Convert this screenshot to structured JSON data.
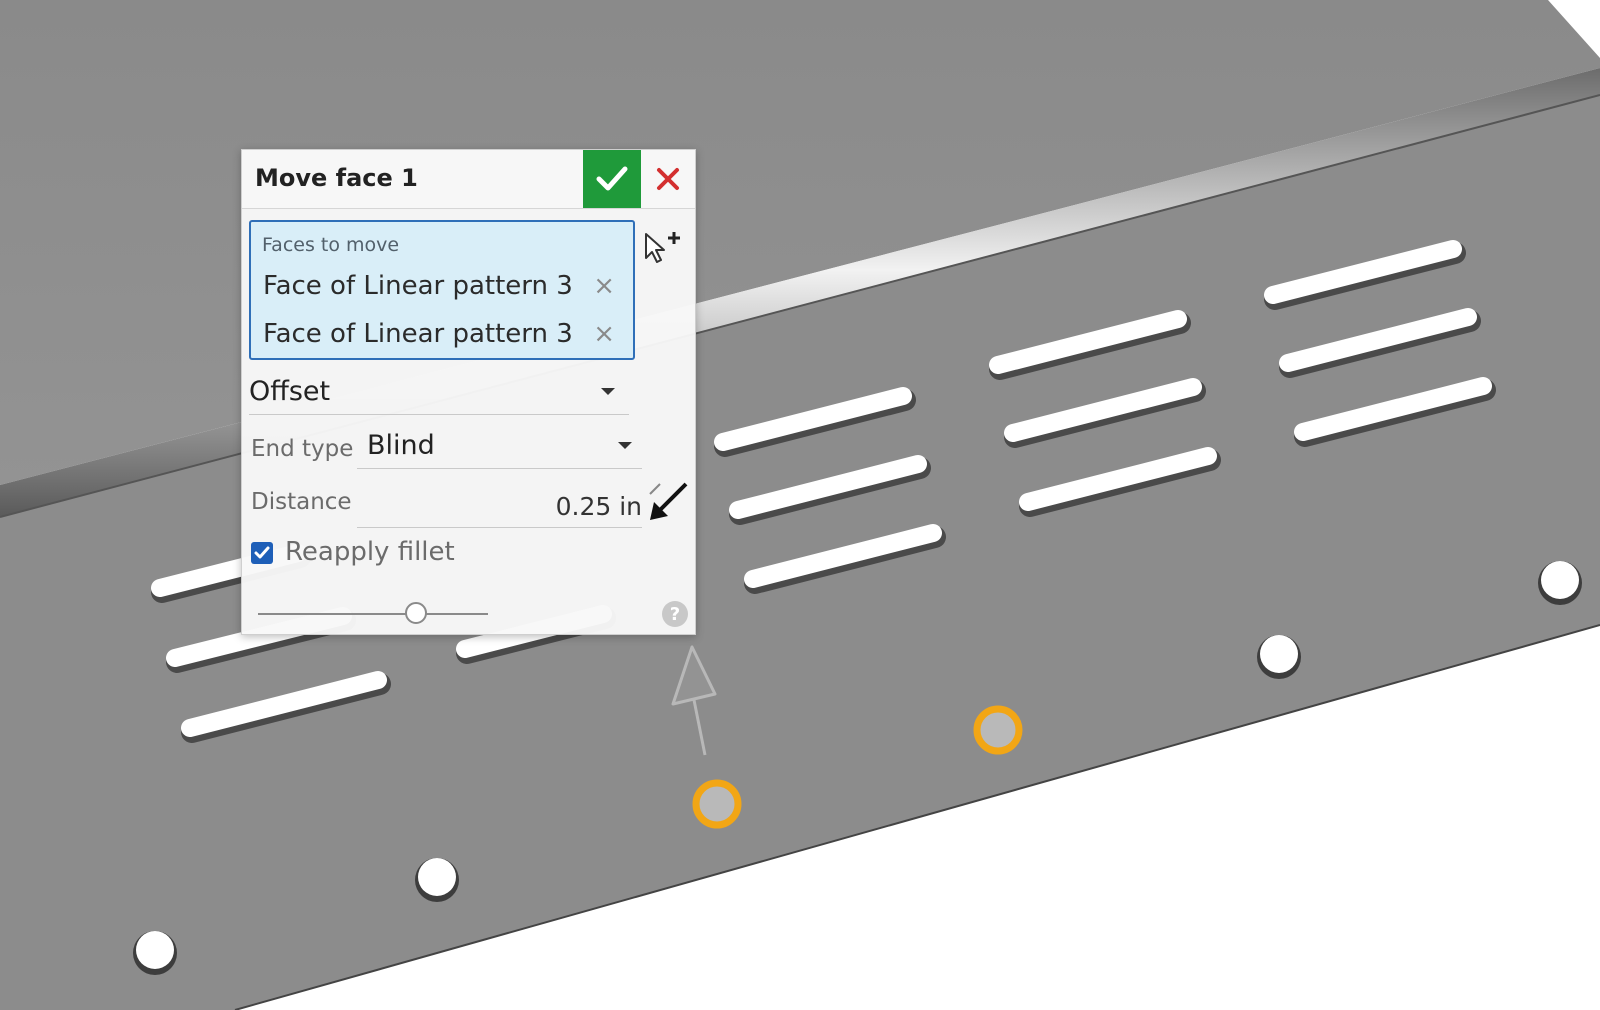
{
  "dialog": {
    "title": "Move face 1",
    "ok_icon": "check-icon",
    "cancel_icon": "close-icon",
    "faces": {
      "label": "Faces to move",
      "items": [
        "Face of Linear pattern 3",
        "Face of Linear pattern 3"
      ],
      "remove_glyph": "×"
    },
    "move_type": "Offset",
    "end_type_label": "End type",
    "end_type_value": "Blind",
    "distance_label": "Distance",
    "distance_value": "0.25 in",
    "reapply_fillet_label": "Reapply fillet",
    "reapply_fillet_checked": true,
    "help_glyph": "?"
  },
  "colors": {
    "accept": "#1f9a3a",
    "cancel": "#d32f2f",
    "selection_bg": "#d9eef8",
    "selection_border": "#2f6fb8",
    "highlight": "#f2a615",
    "sheet_metal": "#8e8e8e"
  }
}
